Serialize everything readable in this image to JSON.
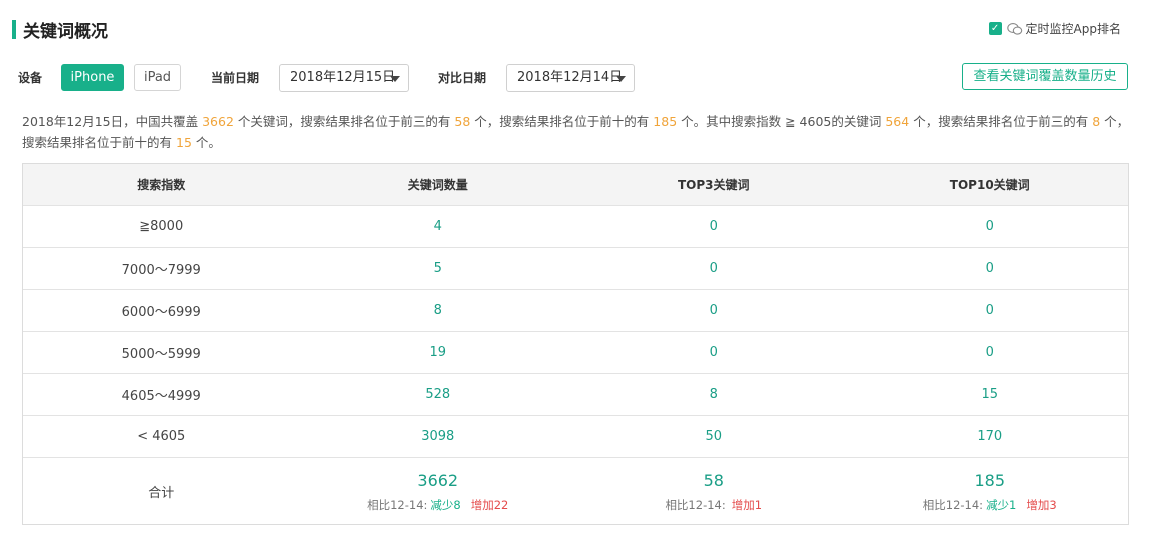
{
  "header": {
    "title": "关键词概况"
  },
  "monitor": {
    "label": "定时监控App排名",
    "checked": true,
    "check_icon": "check-icon",
    "wechat_icon": "wechat-icon"
  },
  "filters": {
    "device_label": "设备",
    "devices": [
      "iPhone",
      "iPad"
    ],
    "selected_device": "iPhone",
    "current_date_label": "当前日期",
    "current_date": "2018年12月15日",
    "compare_date_label": "对比日期",
    "compare_date": "2018年12月14日",
    "history_button": "查看关键词覆盖数量历史"
  },
  "summary": {
    "p1": "2018年12月15日，中国共覆盖",
    "total": "3662",
    "p2": "个关键词，搜索结果排名位于前三的有",
    "top3": "58",
    "p3": "个，搜索结果排名位于前十的有",
    "top10": "185",
    "p4": "个。其中搜索指数 ≧ 4605的关键词",
    "sub_total": "564",
    "p5": "个，搜索结果排名位于前三的有",
    "sub_top3": "8",
    "p6": "个，搜索结果排名位于前十的有",
    "sub_top10": "15",
    "p7": "个。"
  },
  "table": {
    "headers": [
      "搜索指数",
      "关键词数量",
      "TOP3关键词",
      "TOP10关键词"
    ],
    "rows": [
      [
        "≧8000",
        "4",
        "0",
        "0"
      ],
      [
        "7000～7999",
        "5",
        "0",
        "0"
      ],
      [
        "6000～6999",
        "8",
        "0",
        "0"
      ],
      [
        "5000～5999",
        "19",
        "0",
        "0"
      ],
      [
        "4605～4999",
        "528",
        "8",
        "15"
      ],
      [
        "< 4605",
        "3098",
        "50",
        "170"
      ]
    ],
    "total": {
      "label": "合计",
      "cols": [
        {
          "value": "3662",
          "compare": "相比12-14:",
          "decrease": "减少8",
          "increase": "增加22"
        },
        {
          "value": "58",
          "compare": "相比12-14:",
          "decrease": "",
          "increase": "增加1"
        },
        {
          "value": "185",
          "compare": "相比12-14:",
          "decrease": "减少1",
          "increase": "增加3"
        }
      ]
    }
  },
  "colors": {
    "accent": "#18b08a",
    "highlight": "#f0a43a",
    "increase": "#e44b4b"
  }
}
